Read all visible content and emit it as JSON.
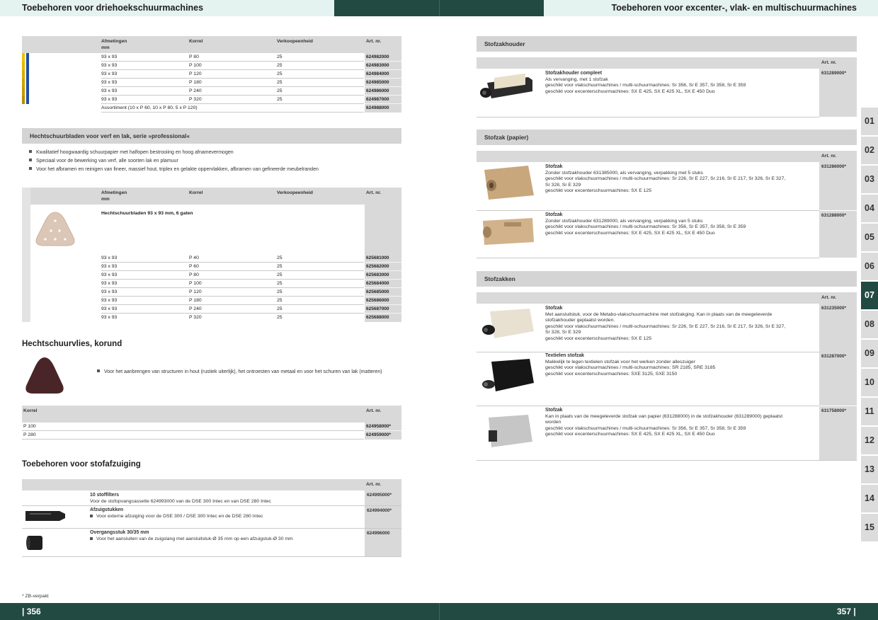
{
  "header": {
    "left_title": "Toebehoren voor driehoekschuurmachines",
    "right_title": "Toebehoren voor excenter-, vlak- en multischuurmachines"
  },
  "footer": {
    "left_page": "| 356",
    "right_page": "357 |",
    "note": "* ZB-verpakt"
  },
  "colors": {
    "brand_dark": "#234a42",
    "header_light": "#e4f2f0",
    "table_gray": "#d9d9d9"
  },
  "table1": {
    "headers": {
      "dim": "Afmetingen",
      "dim_unit": "mm",
      "grit": "Korrel",
      "unit": "Verkoopeenheid",
      "art": "Art. nr."
    },
    "rows": [
      {
        "dim": "93 x 93",
        "grit": "P 80",
        "unit": "25",
        "art": "624982000"
      },
      {
        "dim": "93 x 93",
        "grit": "P 100",
        "unit": "25",
        "art": "624983000"
      },
      {
        "dim": "93 x 93",
        "grit": "P 120",
        "unit": "25",
        "art": "624984000"
      },
      {
        "dim": "93 x 93",
        "grit": "P 180",
        "unit": "25",
        "art": "624985000"
      },
      {
        "dim": "93 x 93",
        "grit": "P 240",
        "unit": "25",
        "art": "624986000"
      },
      {
        "dim": "93 x 93",
        "grit": "P 320",
        "unit": "25",
        "art": "624987000"
      }
    ],
    "assortment": {
      "label": "Assortiment (10 x P 60, 10 x P 80, 5 x P 120)",
      "art": "624988000"
    }
  },
  "professional": {
    "title": "Hechtschuurbladen voor verf en lak, serie »professional«",
    "bullets": [
      "Kwalitatief hoogwaardig schuurpapier met halfopen bestrooiing en hoog afnamevermogen",
      "Speciaal voor de bewerking van verf, alle soorten lak en plamuur",
      "Voor het afbramen en reinigen van fineer, massief hout, triplex en gelakte oppervlakken, afbramen van gefineerde meubelranden"
    ],
    "headers": {
      "dim": "Afmetingen",
      "dim_unit": "mm",
      "grit": "Korrel",
      "unit": "Verkoopeenheid",
      "art": "Art. nr."
    },
    "subtitle": "Hechtschuurbladen 93 x 93 mm, 6 gaten",
    "rows": [
      {
        "dim": "93 x 93",
        "grit": "P 40",
        "unit": "25",
        "art": "625681000"
      },
      {
        "dim": "93 x 93",
        "grit": "P 60",
        "unit": "25",
        "art": "625682000"
      },
      {
        "dim": "93 x 93",
        "grit": "P 80",
        "unit": "25",
        "art": "625683000"
      },
      {
        "dim": "93 x 93",
        "grit": "P 100",
        "unit": "25",
        "art": "625684000"
      },
      {
        "dim": "93 x 93",
        "grit": "P 120",
        "unit": "25",
        "art": "625685000"
      },
      {
        "dim": "93 x 93",
        "grit": "P 180",
        "unit": "25",
        "art": "625686000"
      },
      {
        "dim": "93 x 93",
        "grit": "P 240",
        "unit": "25",
        "art": "625687000"
      },
      {
        "dim": "93 x 93",
        "grit": "P 320",
        "unit": "25",
        "art": "625688000"
      }
    ]
  },
  "vlies": {
    "title": "Hechtschuurvlies, korund",
    "bullet": "Voor het aanbrengen van structuren in hout (rustiek uiterlijk), het ontroesten van metaal en voor het schuren van lak (matteren)",
    "headers": {
      "grit": "Korrel",
      "art": "Art. nr."
    },
    "rows": [
      {
        "grit": "P 100",
        "art": "624958000*"
      },
      {
        "grit": "P 280",
        "art": "624959000*"
      }
    ]
  },
  "stofafzuiging": {
    "title": "Toebehoren voor stofafzuiging",
    "art_header": "Art. nr.",
    "items": [
      {
        "name": "10 stoffilters",
        "desc": "Voor de stofopvangcassette 624993000 van de DSE 300 Intec en van DSE 280 Intec",
        "art": "624995000*"
      },
      {
        "name": "Afzuigstukken",
        "desc": "Voor externe afzuiging voor de DSE 300 / DSE 300 Intec en de DSE 280 Intec",
        "art": "624994000*"
      },
      {
        "name": "Overgangsstuk 30/35 mm",
        "desc": "Voor het aansluiten van de zuigslang met aansluitstuk-Ø 35 mm op een afzuigstuk-Ø 30 mm",
        "art": "624996000"
      }
    ]
  },
  "right": {
    "art_header": "Art. nr.",
    "sections": [
      {
        "title": "Stofzakhouder"
      },
      {
        "title": "Stofzak (papier)"
      },
      {
        "title": "Stofzakken"
      }
    ],
    "products": [
      {
        "name": "Stofzakhouder compleet",
        "lines": [
          "Als vervanging, met 1 stofzak",
          "geschikt voor vlakschuurmachines / multi-schuurmachines: Sr 356, Sr E 357, Sr 358, Sr E 359",
          "geschikt voor excenterschuurmachines: SX E 425, SX E 425 XL, SX E 450 Duo"
        ],
        "art": "631289000*"
      },
      {
        "name": "Stofzak",
        "lines": [
          "Zonder stofzakhouder 631385000, als vervanging, verpakking met 5 stuks",
          "geschikt voor vlakschuurmachines / multi-schuurmachines: Sr 226, Sr E 227, Sr 216, Sr E 217, Sr 326, Sr E 327,",
          "Sr 328, Sr E 329",
          "geschikt voor excenterschuurmachines: SX E 125"
        ],
        "art": "631286000*"
      },
      {
        "name": "Stofzak",
        "lines": [
          "Zonder stofzakhouder 631289000, als vervanging, verpakking van 5 stuks",
          "geschikt voor vlakschuurmachines / multi-schuurmachines: Sr 356, Sr E 357, Sr 358, Sr E 359",
          "geschikt voor excenterschuurmachines: SX E 425, SX E 425 XL, SX E 450 Duo"
        ],
        "art": "631288000*"
      },
      {
        "name": "Stofzak",
        "lines": [
          "Met aansluitstuk, voor de Metabo-vlakschuurmachine met stofzakging. Kan in plaats van de meegeleverde",
          "stofzakhouder geplaatst worden.",
          "geschikt voor vlakschuurmachines / multi-schuurmachines: Sr 226, Sr E 227, Sr 216, Sr E 217, Sr 326, Sr E 327,",
          "Sr 328, Sr E 329",
          "geschikt voor excenterschuurmachines: SX E 125"
        ],
        "art": "631235000*"
      },
      {
        "name": "Textielen stofzak",
        "lines": [
          "Makkelijk te legen textielen stofzak voor het werken zonder alleszuiger",
          "geschikt voor vlakschuurmachines / multi-schuurmachines: SR 2185, SRE 3185",
          "geschikt voor excenterschuurmachines: SXE 3125, SXE 3150"
        ],
        "art": "631287000*"
      },
      {
        "name": "Stofzak",
        "lines": [
          "Kan in plaats van de meegeleverde stofzak van papier (631288000) in de stofzakhouder (631289000) geplaatst",
          "worden",
          "geschikt voor vlakschuurmachines / multi-schuurmachines: Sr 356, Sr E 357, Sr 358, Sr E 359",
          "geschikt voor excenterschuurmachines: SX E 425, SX E 425 XL, SX E 450 Duo"
        ],
        "art": "631758000*"
      }
    ]
  },
  "tabs": [
    "01",
    "02",
    "03",
    "04",
    "05",
    "06",
    "07",
    "08",
    "09",
    "10",
    "11",
    "12",
    "13",
    "14",
    "15"
  ],
  "active_tab": "07"
}
